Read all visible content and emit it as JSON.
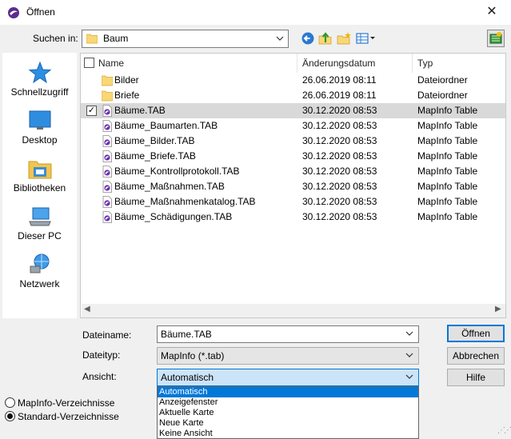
{
  "window": {
    "title": "Öffnen",
    "close_glyph": "✕"
  },
  "toolbar": {
    "look_in_label": "Suchen in:",
    "look_in_value": "Baum",
    "icons": [
      "back-icon",
      "up-folder-icon",
      "new-folder-icon",
      "view-menu-icon",
      "mapinfo-tool-icon"
    ]
  },
  "places": [
    {
      "label": "Schnellzugriff",
      "icon": "quick-access-star-icon"
    },
    {
      "label": "Desktop",
      "icon": "desktop-icon"
    },
    {
      "label": "Bibliotheken",
      "icon": "libraries-icon"
    },
    {
      "label": "Dieser PC",
      "icon": "this-pc-icon"
    },
    {
      "label": "Netzwerk",
      "icon": "network-icon"
    }
  ],
  "file_list": {
    "columns": [
      "Name",
      "Änderungsdatum",
      "Typ"
    ],
    "rows": [
      {
        "name": "Bilder",
        "date": "26.06.2019 08:11",
        "type": "Dateiordner",
        "icon": "folder-icon"
      },
      {
        "name": "Briefe",
        "date": "26.06.2019 08:11",
        "type": "Dateiordner",
        "icon": "folder-icon"
      },
      {
        "name": "Bäume.TAB",
        "date": "30.12.2020 08:53",
        "type": "MapInfo Table",
        "icon": "mapinfo-table-icon",
        "selected": true
      },
      {
        "name": "Bäume_Baumarten.TAB",
        "date": "30.12.2020 08:53",
        "type": "MapInfo Table",
        "icon": "mapinfo-table-icon"
      },
      {
        "name": "Bäume_Bilder.TAB",
        "date": "30.12.2020 08:53",
        "type": "MapInfo Table",
        "icon": "mapinfo-table-icon"
      },
      {
        "name": "Bäume_Briefe.TAB",
        "date": "30.12.2020 08:53",
        "type": "MapInfo Table",
        "icon": "mapinfo-table-icon"
      },
      {
        "name": "Bäume_Kontrollprotokoll.TAB",
        "date": "30.12.2020 08:53",
        "type": "MapInfo Table",
        "icon": "mapinfo-table-icon"
      },
      {
        "name": "Bäume_Maßnahmen.TAB",
        "date": "30.12.2020 08:53",
        "type": "MapInfo Table",
        "icon": "mapinfo-table-icon"
      },
      {
        "name": "Bäume_Maßnahmenkatalog.TAB",
        "date": "30.12.2020 08:53",
        "type": "MapInfo Table",
        "icon": "mapinfo-table-icon"
      },
      {
        "name": "Bäume_Schädigungen.TAB",
        "date": "30.12.2020 08:53",
        "type": "MapInfo Table",
        "icon": "mapinfo-table-icon"
      }
    ]
  },
  "form": {
    "filename_label": "Dateiname:",
    "filename_value": "Bäume.TAB",
    "filetype_label": "Dateityp:",
    "filetype_value": "MapInfo (*.tab)",
    "view_label": "Ansicht:",
    "view_value": "Automatisch",
    "view_options": [
      "Automatisch",
      "Anzeigefenster",
      "Aktuelle Karte",
      "Neue Karte",
      "Keine Ansicht"
    ]
  },
  "buttons": {
    "open": "Öffnen",
    "cancel": "Abbrechen",
    "help": "Hilfe"
  },
  "directories": {
    "options": [
      "MapInfo-Verzeichnisse",
      "Standard-Verzeichnisse"
    ],
    "selected": "Standard-Verzeichnisse"
  },
  "colors": {
    "accent": "#0078d7",
    "selection_row": "#d9d9d9",
    "folder": "#f8d775"
  }
}
